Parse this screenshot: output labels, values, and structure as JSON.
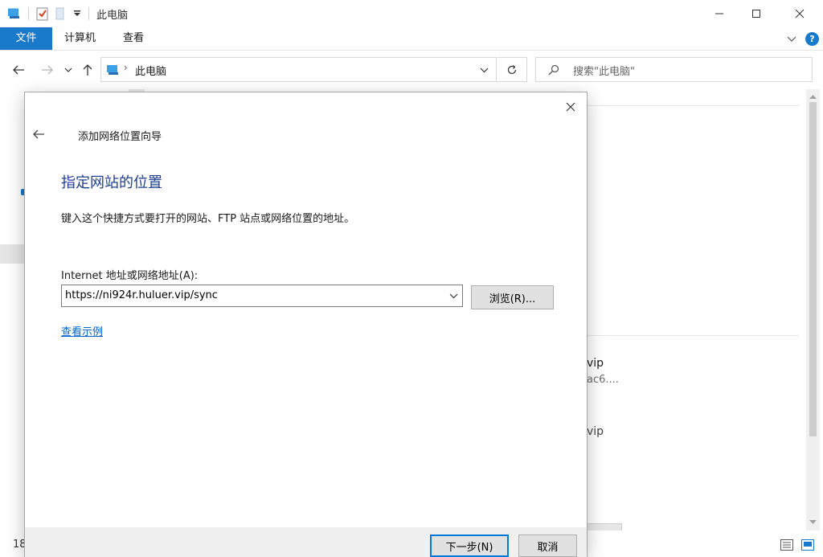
{
  "window": {
    "title": "此电脑",
    "icons": [
      "pc-icon",
      "checkmark-icon",
      "folder-icon"
    ]
  },
  "ribbon": {
    "tabs": [
      "文件",
      "计算机",
      "查看"
    ]
  },
  "address": {
    "path": "此电脑",
    "search_placeholder": "搜索\"此电脑\""
  },
  "background": {
    "partial_text_1": "vip",
    "partial_text_2": "ac6....",
    "partial_text_3": "vip",
    "status_count": "18"
  },
  "dialog": {
    "wizard_title": "添加网络位置向导",
    "heading": "指定网站的位置",
    "description": "键入这个快捷方式要打开的网站、FTP 站点或网络位置的地址。",
    "field_label": "Internet 地址或网络地址(A):",
    "field_value": "https://ni924r.huluer.vip/sync",
    "browse_label": "浏览(R)...",
    "example_link": "查看示例",
    "next_label": "下一步(N)",
    "cancel_label": "取消"
  },
  "colors": {
    "accent": "#1979ca",
    "heading": "#1e3e90",
    "link": "#0066cc",
    "help": "#1979ca"
  }
}
